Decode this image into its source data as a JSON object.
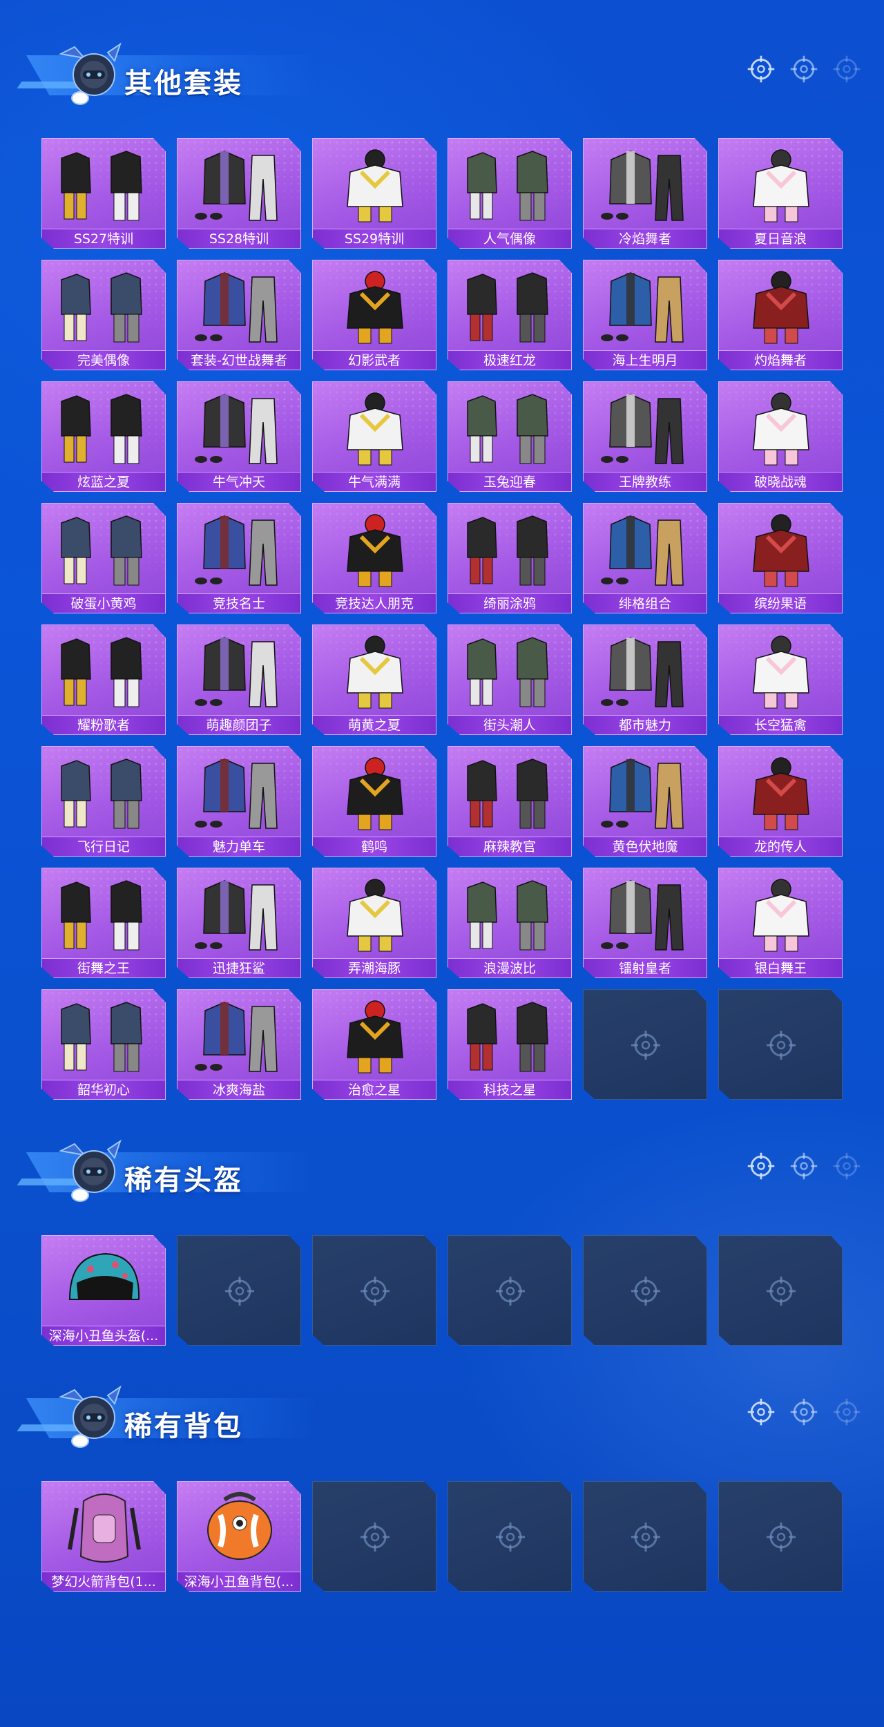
{
  "sections": [
    {
      "title": "其他套装",
      "items": [
        "SS27特训",
        "SS28特训",
        "SS29特训",
        "人气偶像",
        "冷焰舞者",
        "夏日音浪",
        "完美偶像",
        "套装-幻世战舞者",
        "幻影武者",
        "极速红龙",
        "海上生明月",
        "灼焰舞者",
        "炫蓝之夏",
        "牛气冲天",
        "牛气满满",
        "玉兔迎春",
        "王牌教练",
        "破晓战魂",
        "破蛋小黄鸡",
        "竞技名士",
        "竞技达人朋克",
        "绮丽涂鸦",
        "绯格组合",
        "缤纷果语",
        "耀粉歌者",
        "萌趣颜团子",
        "萌黄之夏",
        "街头潮人",
        "都市魅力",
        "长空猛禽",
        "飞行日记",
        "魅力单车",
        "鹤鸣",
        "麻辣教官",
        "黄色伏地魔",
        "龙的传人",
        "街舞之王",
        "迅捷狂鲨",
        "弄潮海豚",
        "浪漫波比",
        "镭射皇者",
        "银白舞王",
        "韶华初心",
        "冰爽海盐",
        "治愈之星",
        "科技之星"
      ],
      "empty_slots": 2
    },
    {
      "title": "稀有头盔",
      "items": [
        "深海小丑鱼头盔(..."
      ],
      "empty_slots": 5
    },
    {
      "title": "稀有背包",
      "items": [
        "梦幻火箭背包(1...",
        "深海小丑鱼背包(..."
      ],
      "empty_slots": 4
    }
  ],
  "icons": {
    "empty_slot": "crosshair-icon",
    "header_decoration": "crosshair-icon",
    "mascot": "mascot-icon"
  },
  "colors": {
    "background": "#0b55d8",
    "card_purple": "#a65ce6",
    "label_bar": "#7c2fd1",
    "empty_slot": "#1e3560"
  }
}
